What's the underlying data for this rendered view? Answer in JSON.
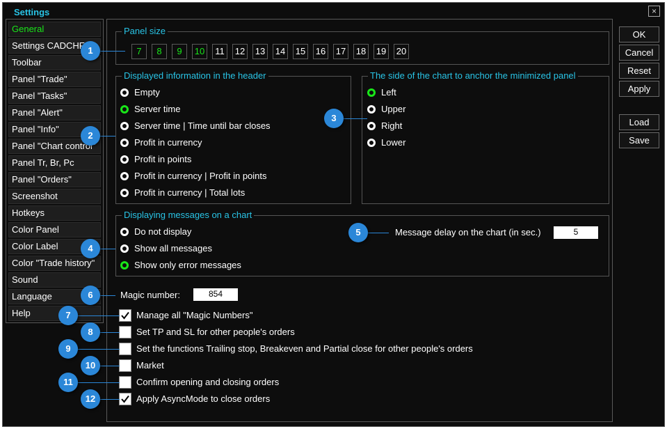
{
  "window": {
    "title": "Settings",
    "close_icon": "×"
  },
  "sidebar": {
    "items": [
      {
        "label": "General",
        "active": true
      },
      {
        "label": "Settings CADCHF",
        "active": false
      },
      {
        "label": "Toolbar",
        "active": false
      },
      {
        "label": "Panel \"Trade\"",
        "active": false
      },
      {
        "label": "Panel \"Tasks\"",
        "active": false
      },
      {
        "label": "Panel \"Alert\"",
        "active": false
      },
      {
        "label": "Panel \"Info\"",
        "active": false
      },
      {
        "label": "Panel \"Chart control\"",
        "active": false
      },
      {
        "label": "Panel Tr, Br, Pc",
        "active": false
      },
      {
        "label": "Panel \"Orders\"",
        "active": false
      },
      {
        "label": "Screenshot",
        "active": false
      },
      {
        "label": "Hotkeys",
        "active": false
      },
      {
        "label": "Color Panel",
        "active": false
      },
      {
        "label": "Color Label",
        "active": false
      },
      {
        "label": "Color \"Trade history\"",
        "active": false
      },
      {
        "label": "Sound",
        "active": false
      },
      {
        "label": "Language",
        "active": false
      },
      {
        "label": "Help",
        "active": false
      }
    ]
  },
  "panel_size": {
    "title": "Panel size",
    "sizes": [
      {
        "label": "7",
        "enabled": true
      },
      {
        "label": "8",
        "enabled": true
      },
      {
        "label": "9",
        "enabled": true
      },
      {
        "label": "10",
        "enabled": true
      },
      {
        "label": "11",
        "enabled": false
      },
      {
        "label": "12",
        "enabled": false
      },
      {
        "label": "13",
        "enabled": false
      },
      {
        "label": "14",
        "enabled": false
      },
      {
        "label": "15",
        "enabled": false
      },
      {
        "label": "16",
        "enabled": false
      },
      {
        "label": "17",
        "enabled": false
      },
      {
        "label": "18",
        "enabled": false
      },
      {
        "label": "19",
        "enabled": false
      },
      {
        "label": "20",
        "enabled": false
      }
    ]
  },
  "header_info": {
    "title": "Displayed information in the header",
    "options": [
      {
        "label": "Empty",
        "selected": false
      },
      {
        "label": "Server time",
        "selected": true
      },
      {
        "label": "Server time | Time until bar closes",
        "selected": false
      },
      {
        "label": "Profit in currency",
        "selected": false
      },
      {
        "label": "Profit in points",
        "selected": false
      },
      {
        "label": "Profit in currency | Profit in points",
        "selected": false
      },
      {
        "label": "Profit in currency | Total lots",
        "selected": false
      }
    ]
  },
  "anchor_side": {
    "title": "The side of the chart to anchor the minimized panel",
    "options": [
      {
        "label": "Left",
        "selected": true
      },
      {
        "label": "Upper",
        "selected": false
      },
      {
        "label": "Right",
        "selected": false
      },
      {
        "label": "Lower",
        "selected": false
      }
    ]
  },
  "messages": {
    "title": "Displaying messages on a chart",
    "options": [
      {
        "label": "Do not display",
        "selected": false
      },
      {
        "label": "Show all messages",
        "selected": false
      },
      {
        "label": "Show only error messages",
        "selected": true
      }
    ],
    "delay_label": "Message delay on the chart (in sec.)",
    "delay_value": "5"
  },
  "magic": {
    "label": "Magic number:",
    "value": "854"
  },
  "checkboxes": [
    {
      "label": "Manage all \"Magic Numbers\"",
      "checked": true
    },
    {
      "label": "Set TP and SL for other people's orders",
      "checked": false
    },
    {
      "label": "Set the functions Trailing stop, Breakeven and Partial close for other people's orders",
      "checked": false
    },
    {
      "label": "Market",
      "checked": false
    },
    {
      "label": "Confirm opening and closing orders",
      "checked": false
    },
    {
      "label": "Apply AsyncMode to close orders",
      "checked": true
    }
  ],
  "buttons": {
    "ok": "OK",
    "cancel": "Cancel",
    "reset": "Reset",
    "apply": "Apply",
    "load": "Load",
    "save": "Save"
  },
  "callouts": [
    "1",
    "2",
    "3",
    "4",
    "5",
    "6",
    "7",
    "8",
    "9",
    "10",
    "11",
    "12"
  ],
  "colors": {
    "accent_cyan": "#29c4e6",
    "selected_green": "#19e619",
    "callout_blue": "#2b87d8",
    "background": "#0d0d0d"
  }
}
